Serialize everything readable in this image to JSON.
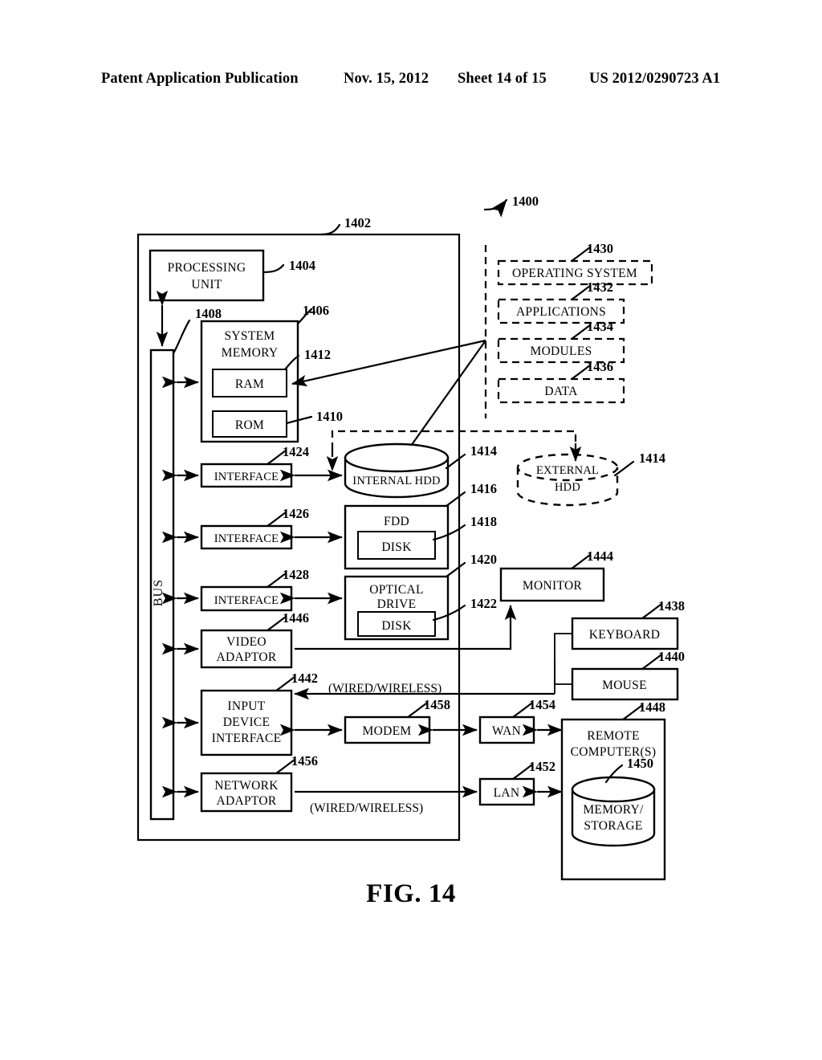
{
  "header": {
    "publication": "Patent Application Publication",
    "date": "Nov. 15, 2012",
    "sheet": "Sheet 14 of 15",
    "number": "US 2012/0290723 A1"
  },
  "figure": {
    "caption": "FIG. 14",
    "system_ref": "1400"
  },
  "blocks": {
    "computer_enclosure": {
      "ref": "1402",
      "label": ""
    },
    "processing_unit": {
      "ref": "1404",
      "label_line1": "PROCESSING",
      "label_line2": "UNIT"
    },
    "system_memory": {
      "ref": "1406",
      "label_line1": "SYSTEM",
      "label_line2": "MEMORY"
    },
    "bus": {
      "ref": "1408",
      "label": "BUS"
    },
    "rom": {
      "ref": "1410",
      "label": "ROM"
    },
    "ram": {
      "ref": "1412",
      "label": "RAM"
    },
    "internal_hdd": {
      "ref": "1414",
      "label": "INTERNAL HDD"
    },
    "external_hdd": {
      "ref": "1414",
      "label_line1": "EXTERNAL",
      "label_line2": "HDD"
    },
    "fdd": {
      "ref": "1416",
      "label": "FDD"
    },
    "fdd_disk": {
      "ref": "1418",
      "label": "DISK"
    },
    "optical_drive": {
      "ref": "1420",
      "label_line1": "OPTICAL",
      "label_line2": "DRIVE"
    },
    "optical_disk": {
      "ref": "1422",
      "label": "DISK"
    },
    "interface_hdd": {
      "ref": "1424",
      "label": "INTERFACE"
    },
    "interface_fdd": {
      "ref": "1426",
      "label": "INTERFACE"
    },
    "interface_optical": {
      "ref": "1428",
      "label": "INTERFACE"
    },
    "operating_system": {
      "ref": "1430",
      "label": "OPERATING SYSTEM"
    },
    "applications": {
      "ref": "1432",
      "label": "APPLICATIONS"
    },
    "modules": {
      "ref": "1434",
      "label": "MODULES"
    },
    "data": {
      "ref": "1436",
      "label": "DATA"
    },
    "keyboard": {
      "ref": "1438",
      "label": "KEYBOARD"
    },
    "mouse": {
      "ref": "1440",
      "label": "MOUSE"
    },
    "input_device_interface": {
      "ref": "1442",
      "label_line1": "INPUT",
      "label_line2": "DEVICE",
      "label_line3": "INTERFACE"
    },
    "monitor": {
      "ref": "1444",
      "label": "MONITOR"
    },
    "video_adaptor": {
      "ref": "1446",
      "label_line1": "VIDEO",
      "label_line2": "ADAPTOR"
    },
    "remote_computers": {
      "ref": "1448",
      "label_line1": "REMOTE",
      "label_line2": "COMPUTER(S)"
    },
    "memory_storage": {
      "ref": "1450",
      "label_line1": "MEMORY/",
      "label_line2": "STORAGE"
    },
    "lan": {
      "ref": "1452",
      "label": "LAN"
    },
    "wan": {
      "ref": "1454",
      "label": "WAN"
    },
    "network_adaptor": {
      "ref": "1456",
      "label_line1": "NETWORK",
      "label_line2": "ADAPTOR"
    },
    "modem": {
      "ref": "1458",
      "label": "MODEM"
    }
  },
  "annotations": {
    "wired_wireless_top": "(WIRED/WIRELESS)",
    "wired_wireless_bottom": "(WIRED/WIRELESS)"
  },
  "colors": {
    "ink": "#000000",
    "paper": "#ffffff"
  }
}
